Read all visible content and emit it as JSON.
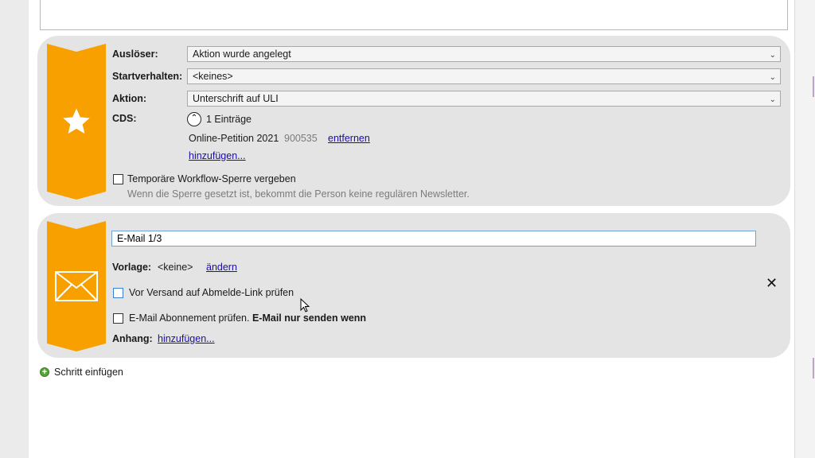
{
  "step1": {
    "icon": "star-icon",
    "trigger": {
      "label": "Auslöser:",
      "value": "Aktion wurde angelegt"
    },
    "start_behavior": {
      "label": "Startverhalten:",
      "value": "<keines>"
    },
    "action": {
      "label": "Aktion:",
      "value": "Unterschrift auf ULI"
    },
    "cds": {
      "label": "CDS:",
      "count_text": "1 Einträge",
      "entry_name": "Online-Petition 2021",
      "entry_id": "900535",
      "remove_link": "entfernen",
      "add_link": "hinzufügen..."
    },
    "lock": {
      "label": "Temporäre Workflow-Sperre vergeben",
      "checked": false,
      "hint": "Wenn die Sperre gesetzt ist, bekommt die Person keine regulären Newsletter."
    }
  },
  "step2": {
    "icon": "envelope-icon",
    "name_value": "E-Mail 1/3",
    "template": {
      "label": "Vorlage:",
      "value": "<keine>",
      "change_link": "ändern"
    },
    "check_unsubscribe": {
      "label": "Vor Versand auf Abmelde-Link prüfen",
      "checked": false
    },
    "check_subscription": {
      "label": "E-Mail Abonnement prüfen.",
      "bold_suffix": "E-Mail nur senden wenn",
      "checked": false
    },
    "attachment": {
      "label": "Anhang:",
      "add_link": "hinzufügen..."
    },
    "close_icon": "close-icon"
  },
  "add_step": {
    "label": "Schritt einfügen",
    "icon": "plus-circle-icon"
  }
}
